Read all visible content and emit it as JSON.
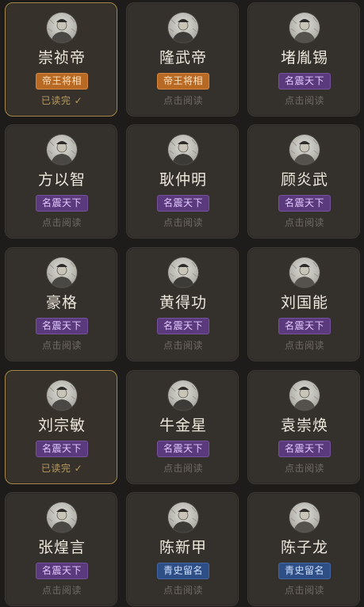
{
  "colors": {
    "page_background": "#1e1c1a",
    "card_background": "#34302c",
    "read_card_border": "#a98a48",
    "badge_orange": "#b86a25",
    "badge_purple": "#5a3a7c",
    "badge_blue": "#2e4e86",
    "status_done": "#b69b62",
    "status_unread": "#6f6a63"
  },
  "cards": [
    {
      "name": "崇祯帝",
      "badge": "帝王将相",
      "badge_style": "orange",
      "status": "已读完 ✓",
      "read": true,
      "icon": "portrait-icon"
    },
    {
      "name": "隆武帝",
      "badge": "帝王将相",
      "badge_style": "orange",
      "status": "点击阅读",
      "read": false,
      "icon": "portrait-icon"
    },
    {
      "name": "堵胤锡",
      "badge": "名震天下",
      "badge_style": "purple",
      "status": "点击阅读",
      "read": false,
      "icon": "portrait-icon"
    },
    {
      "name": "方以智",
      "badge": "名震天下",
      "badge_style": "purple",
      "status": "点击阅读",
      "read": false,
      "icon": "portrait-icon"
    },
    {
      "name": "耿仲明",
      "badge": "名震天下",
      "badge_style": "purple",
      "status": "点击阅读",
      "read": false,
      "icon": "portrait-icon"
    },
    {
      "name": "顾炎武",
      "badge": "名震天下",
      "badge_style": "purple",
      "status": "点击阅读",
      "read": false,
      "icon": "portrait-icon"
    },
    {
      "name": "豪格",
      "badge": "名震天下",
      "badge_style": "purple",
      "status": "点击阅读",
      "read": false,
      "icon": "portrait-icon"
    },
    {
      "name": "黄得功",
      "badge": "名震天下",
      "badge_style": "purple",
      "status": "点击阅读",
      "read": false,
      "icon": "portrait-icon"
    },
    {
      "name": "刘国能",
      "badge": "名震天下",
      "badge_style": "purple",
      "status": "点击阅读",
      "read": false,
      "icon": "portrait-icon"
    },
    {
      "name": "刘宗敏",
      "badge": "名震天下",
      "badge_style": "purple",
      "status": "已读完 ✓",
      "read": true,
      "icon": "portrait-icon"
    },
    {
      "name": "牛金星",
      "badge": "名震天下",
      "badge_style": "purple",
      "status": "点击阅读",
      "read": false,
      "icon": "portrait-icon"
    },
    {
      "name": "袁崇焕",
      "badge": "名震天下",
      "badge_style": "purple",
      "status": "点击阅读",
      "read": false,
      "icon": "portrait-icon"
    },
    {
      "name": "张煌言",
      "badge": "名震天下",
      "badge_style": "purple",
      "status": "点击阅读",
      "read": false,
      "icon": "portrait-icon"
    },
    {
      "name": "陈新甲",
      "badge": "青史留名",
      "badge_style": "blue",
      "status": "点击阅读",
      "read": false,
      "icon": "portrait-icon"
    },
    {
      "name": "陈子龙",
      "badge": "青史留名",
      "badge_style": "blue",
      "status": "点击阅读",
      "read": false,
      "icon": "portrait-icon"
    }
  ]
}
